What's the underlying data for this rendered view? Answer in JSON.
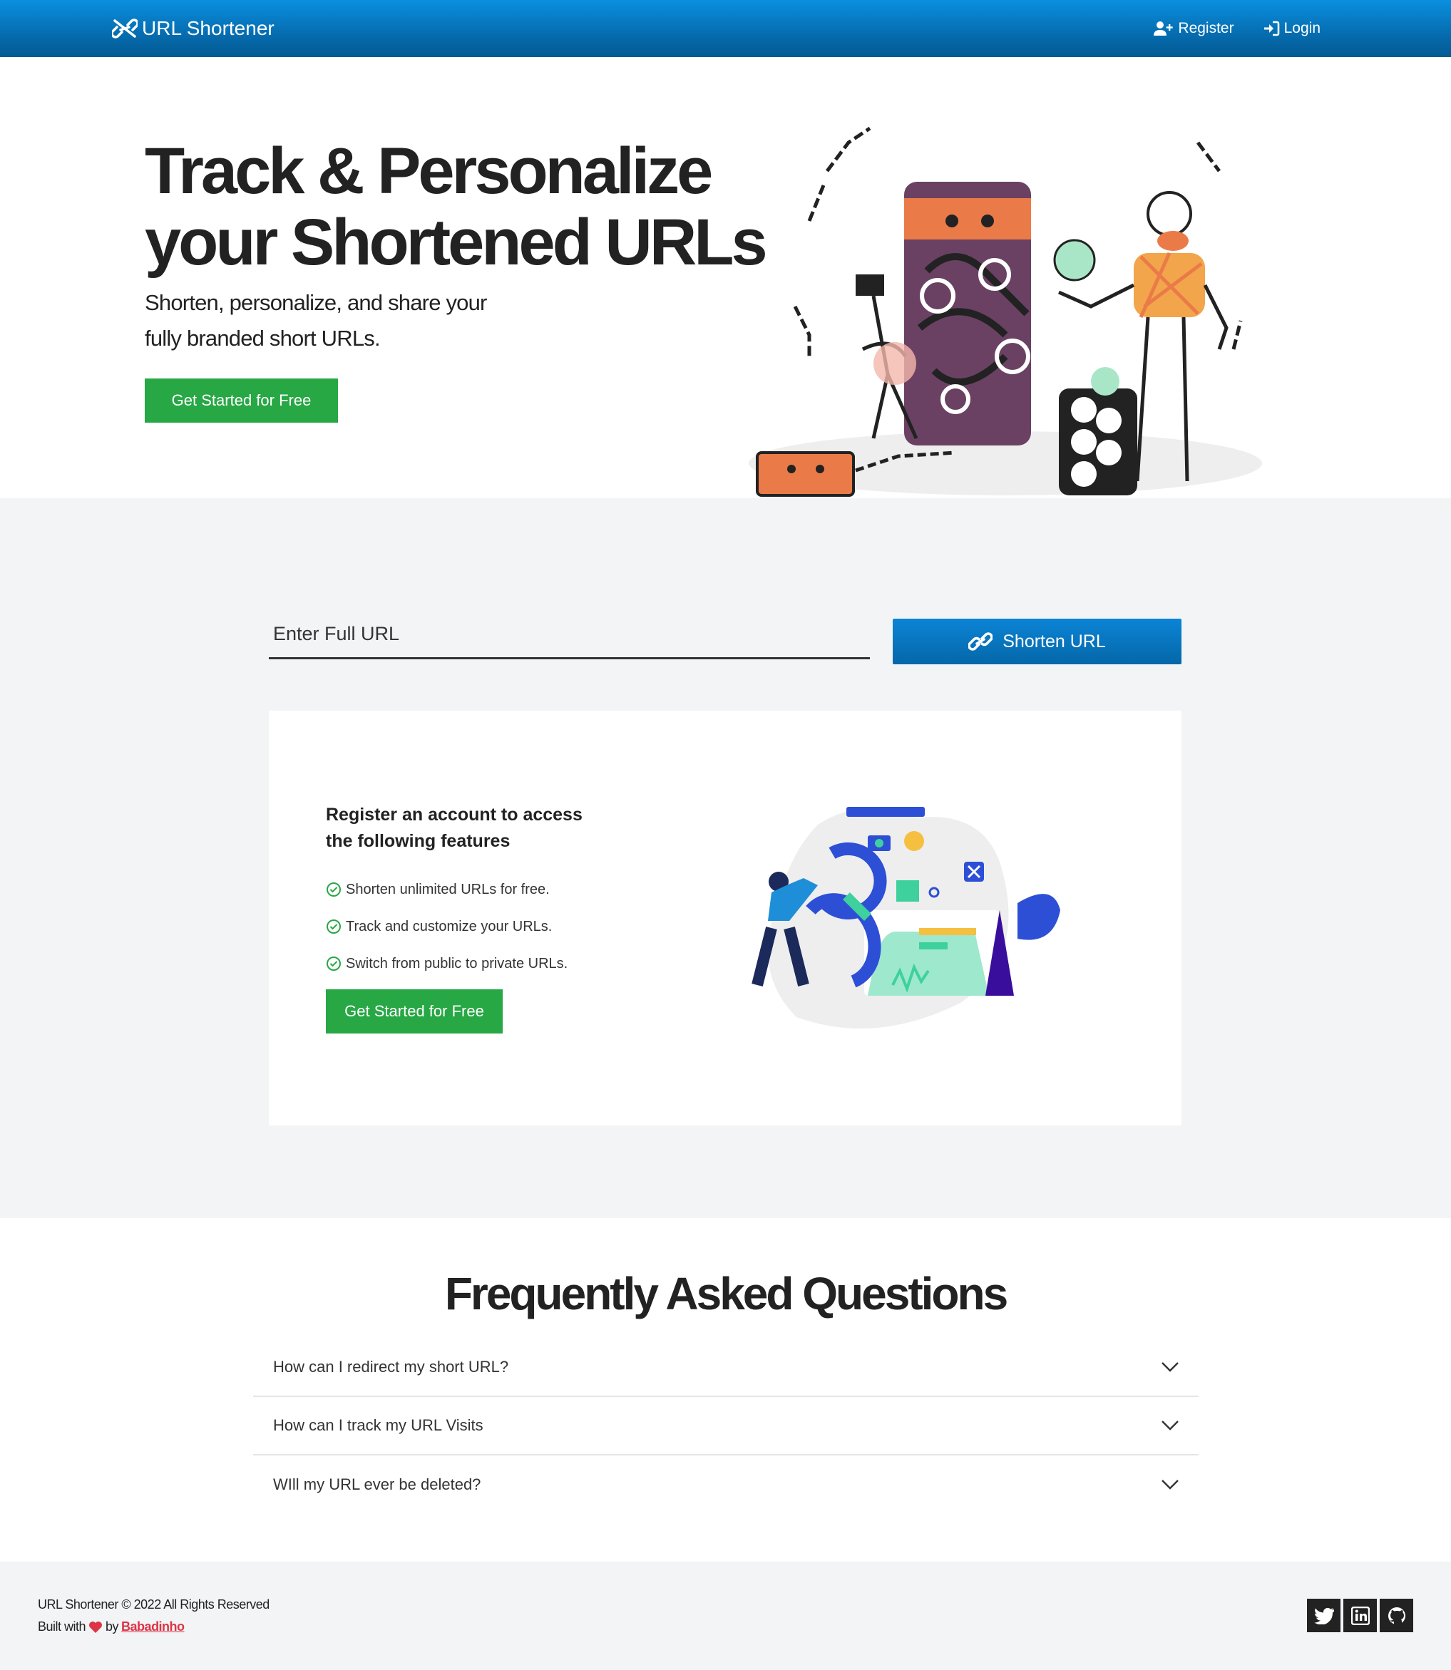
{
  "nav": {
    "brand": "URL Shortener",
    "register": "Register",
    "login": "Login"
  },
  "hero": {
    "title": "Track & Personalize your Shortened URLs",
    "subtitle_line1": "Shorten, personalize, and share your",
    "subtitle_line2": "fully branded short URLs.",
    "cta": "Get Started for Free"
  },
  "shorten": {
    "placeholder": "Enter Full URL",
    "button": "Shorten URL"
  },
  "features": {
    "heading": "Register an account to access the following features",
    "items": [
      "Shorten unlimited URLs for free.",
      "Track and customize your URLs.",
      "Switch from public to private URLs."
    ],
    "cta": "Get Started for Free"
  },
  "faq": {
    "title": "Frequently Asked Questions",
    "items": [
      "How can I redirect my short URL?",
      "How can I track my URL Visits",
      "WIll my URL ever be deleted?"
    ]
  },
  "footer": {
    "copyright": "URL Shortener © 2022 All Rights Reserved",
    "built_with": "Built with",
    "by": "by",
    "author": "Babadinho",
    "socials": [
      "twitter-icon",
      "linkedin-icon",
      "github-icon"
    ]
  },
  "colors": {
    "nav_top": "#0a8fe0",
    "nav_bottom": "#045a92",
    "cta_green": "#28a745",
    "section_bg": "#f3f4f6",
    "author_red": "#dc3545"
  }
}
